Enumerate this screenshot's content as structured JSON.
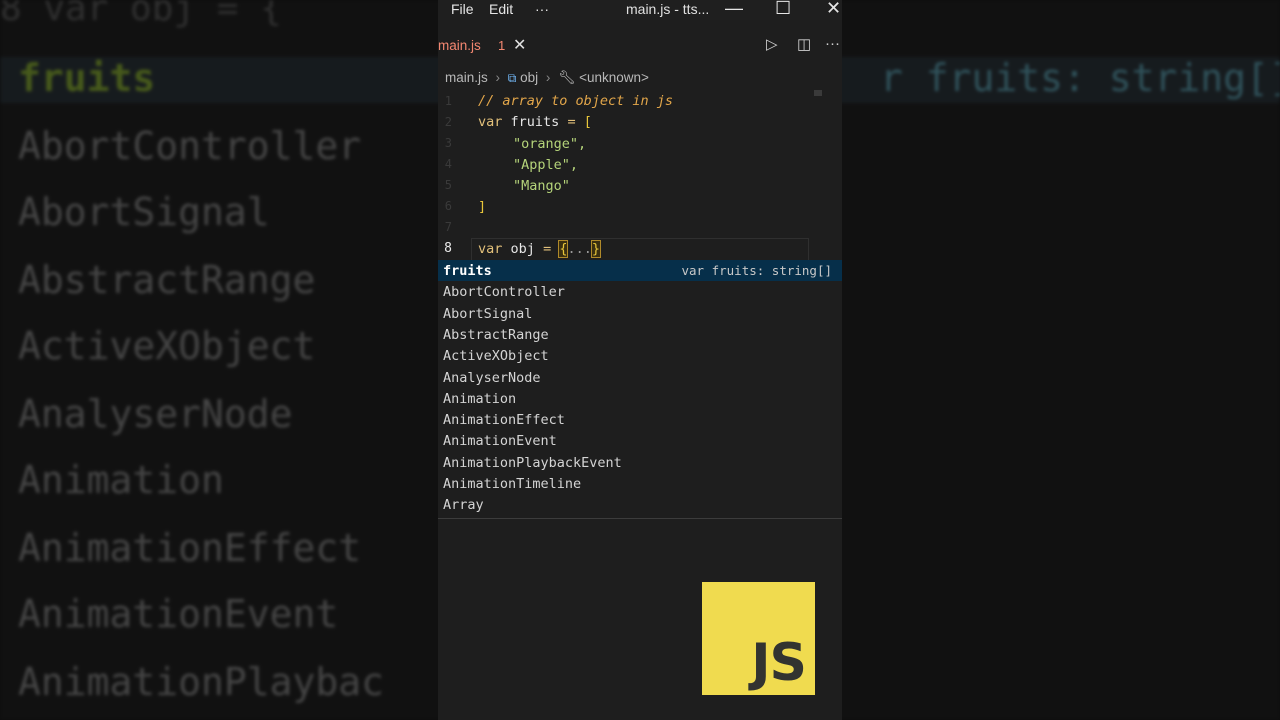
{
  "background": {
    "top_text": "8    var obj = {",
    "right_text": "r fruits: string[]",
    "items": [
      "fruits",
      "AbortController",
      "AbortSignal",
      "AbstractRange",
      "ActiveXObject",
      "AnalyserNode",
      "Animation",
      "AnimationEffect",
      "AnimationEvent",
      "AnimationPlaybac"
    ]
  },
  "window": {
    "menu": [
      "File",
      "Edit",
      "···"
    ],
    "title": "main.js - tts...",
    "controls": {
      "minimize": "—",
      "maximize": "☐",
      "close": "✕"
    }
  },
  "tab": {
    "name": "main.js",
    "problems": "1",
    "close": "✕"
  },
  "tab_actions": {
    "run": "▷",
    "split": "◫",
    "more": "···"
  },
  "breadcrumb": {
    "file": "main.js",
    "symbol": "obj",
    "context": "<unknown>"
  },
  "code": {
    "line_numbers": [
      "1",
      "2",
      "3",
      "4",
      "5",
      "6",
      "7",
      "8"
    ],
    "comment": "// array to object in js",
    "kw": "var",
    "fruits_name": "fruits",
    "eq": "=",
    "open_bracket": "[",
    "strings": [
      "\"orange\",",
      "\"Apple\",",
      "\"Mango\""
    ],
    "close_bracket": "]",
    "obj_name": "obj",
    "open_brace": "{",
    "spread": "...",
    "close_brace": "}"
  },
  "suggestions": {
    "selected_detail": "var fruits: string[]",
    "items": [
      "fruits",
      "AbortController",
      "AbortSignal",
      "AbstractRange",
      "ActiveXObject",
      "AnalyserNode",
      "Animation",
      "AnimationEffect",
      "AnimationEvent",
      "AnimationPlaybackEvent",
      "AnimationTimeline",
      "Array"
    ]
  },
  "logo": {
    "text": "JS"
  },
  "colors": {
    "accent": "#f0db4f",
    "selection": "#062f4a",
    "error": "#f48771"
  }
}
